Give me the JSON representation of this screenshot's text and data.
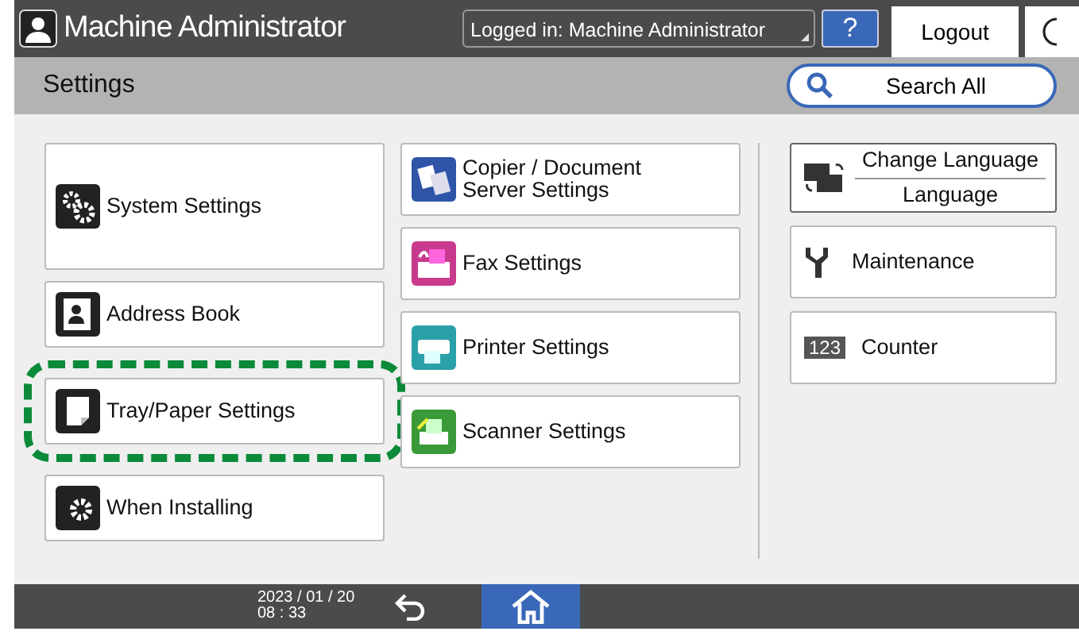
{
  "header": {
    "title": "Machine Administrator",
    "login_status": "Logged in: Machine Administrator",
    "help": "?",
    "logout": "Logout"
  },
  "subheader": {
    "title": "Settings",
    "search": "Search All"
  },
  "columns": [
    [
      {
        "lines": [
          "System Settings"
        ],
        "kind": "tall",
        "highlighted": false
      },
      {
        "lines": [
          "Address Book"
        ],
        "kind": "normal",
        "highlighted": false
      },
      {
        "lines": [
          "Tray/Paper Settings"
        ],
        "kind": "normal",
        "highlighted": true
      },
      {
        "lines": [
          "When Installing"
        ],
        "kind": "normal",
        "highlighted": false
      }
    ],
    [
      {
        "lines": [
          "Copier / Document",
          "Server Settings"
        ],
        "kind": "normal",
        "highlighted": false
      },
      {
        "lines": [
          "Fax Settings"
        ],
        "kind": "normal",
        "highlighted": false
      },
      {
        "lines": [
          "Printer Settings"
        ],
        "kind": "normal",
        "highlighted": false
      },
      {
        "lines": [
          "Scanner Settings"
        ],
        "kind": "normal",
        "highlighted": false
      }
    ]
  ],
  "language": {
    "title": "Change Language",
    "value": "Language"
  },
  "tools": [
    {
      "label": "Maintenance"
    },
    {
      "label": "Counter",
      "badge": "123"
    }
  ],
  "footer": {
    "date": "2023 / 01 / 20",
    "time": "08 : 33"
  }
}
